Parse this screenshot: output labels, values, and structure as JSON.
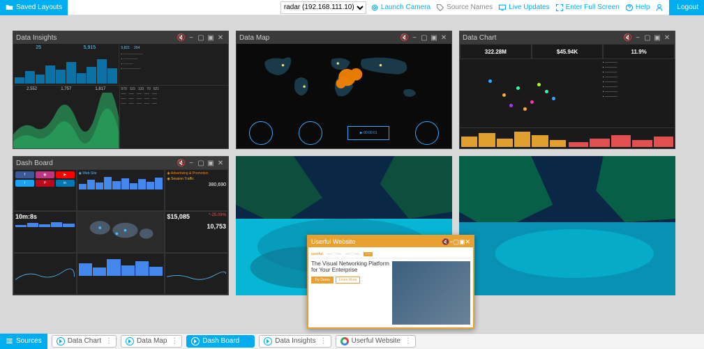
{
  "topbar": {
    "saved_layouts": "Saved Layouts",
    "host_select": "radar (192.168.111.10)",
    "launch_camera": "Launch Camera",
    "source_names": "Source Names",
    "live_updates": "Live Updates",
    "fullscreen": "Enter Full Screen",
    "help": "Help",
    "logout": "Logout"
  },
  "panels": {
    "data_insights": {
      "title": "Data Insights",
      "top_stats": [
        "25",
        "5,915",
        "5,821",
        "204"
      ],
      "bot_stats": [
        "2,552",
        "1,757",
        "1,817"
      ],
      "table_cols": [
        "570",
        "115",
        "133",
        "70",
        "621"
      ]
    },
    "data_map": {
      "title": "Data Map"
    },
    "data_chart": {
      "title": "Data Chart",
      "stat1": "322.28M",
      "stat2": "$45.94K",
      "stat3": "11.9%"
    },
    "dash_board": {
      "title": "Dash Board",
      "time_stat": "10m:8s",
      "revenue": "$15,085",
      "pct": "^-25.09%",
      "big_num": "10,753",
      "other_num": "380,690"
    },
    "userful": {
      "title": "Userful Website",
      "brand": "userful",
      "headline": "The Visual Networking Platform for Your Enterprise",
      "btn1": "Try Demo",
      "btn2": "Learn More"
    }
  },
  "bottombar": {
    "sources": "Sources",
    "pills": [
      "Data Chart",
      "Data Map",
      "Dash Board",
      "Data Insights",
      "Userful Website"
    ]
  }
}
